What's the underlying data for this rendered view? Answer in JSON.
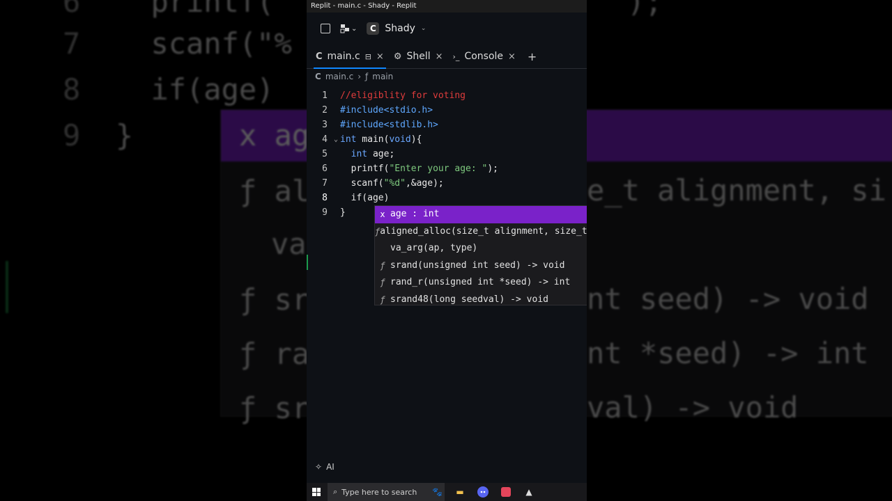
{
  "window": {
    "title": "Replit - main.c - Shady - Replit"
  },
  "toolbar": {
    "project_name": "Shady",
    "logo_letter": "C"
  },
  "tabs": [
    {
      "label": "main.c",
      "icon": "c-file-icon",
      "active": true
    },
    {
      "label": "Shell",
      "icon": "shell-icon",
      "active": false
    },
    {
      "label": "Console",
      "icon": "console-icon",
      "active": false
    }
  ],
  "tab_icons": {
    "c": "C",
    "shell": "⚙",
    "console": "›_",
    "close": "×",
    "add": "+"
  },
  "breadcrumb": {
    "file": "main.c",
    "symbol_icon": "ƒ",
    "symbol": "main"
  },
  "editor": {
    "lines": [
      {
        "num": "1",
        "code": "//eligiblity for voting"
      },
      {
        "num": "2",
        "code": "#include<stdio.h>"
      },
      {
        "num": "3",
        "code": "#include<stdlib.h>"
      },
      {
        "num": "4",
        "kw": "int",
        "fn": " main(",
        "kw2": "void",
        "rest": "){"
      },
      {
        "num": "5",
        "indent": "  ",
        "kw": "int",
        "rest": " age;"
      },
      {
        "num": "6",
        "indent": "  ",
        "pre": "printf(",
        "str": "\"Enter your age: \"",
        "rest": ");"
      },
      {
        "num": "7",
        "indent": "  ",
        "pre": "scanf(",
        "str": "\"%d\"",
        "rest": ",&age);"
      },
      {
        "num": "8",
        "indent": "  ",
        "code": "if(age)"
      },
      {
        "num": "9",
        "code": "}"
      }
    ],
    "fold_marker": "⌄"
  },
  "suggestions": [
    {
      "kind": "x",
      "text": "age : int",
      "selected": true
    },
    {
      "kind": "ƒ",
      "text": "aligned_alloc(size_t alignment, size_t size)",
      "selected": false
    },
    {
      "kind": "",
      "text": "va_arg(ap, type)",
      "selected": false
    },
    {
      "kind": "ƒ",
      "text": "srand(unsigned int seed) -> void",
      "selected": false
    },
    {
      "kind": "ƒ",
      "text": "rand_r(unsigned int *seed) -> int",
      "selected": false
    },
    {
      "kind": "ƒ",
      "text": "srand48(long seedval) -> void",
      "selected": false
    }
  ],
  "aibar": {
    "label": "AI",
    "icon": "✧"
  },
  "taskbar": {
    "search_placeholder": "Type here to search",
    "search_icon": "⌕"
  },
  "background_zoom": {
    "lines": [
      {
        "num": "6",
        "code": "printf(",
        "tail": ");"
      },
      {
        "num": "7",
        "code": "scanf(\"%"
      },
      {
        "num": "8",
        "code": "if(age)"
      },
      {
        "num": "9",
        "code": "}"
      }
    ],
    "popup_items": [
      "x ag",
      "ƒ al",
      "va",
      "ƒ sr",
      "ƒ ra",
      "ƒ sr"
    ],
    "popup_right": [
      "e_t alignment, si",
      "",
      "nt seed) -> void",
      "nt *seed) -> int",
      "val) -> void"
    ]
  },
  "colors": {
    "accent": "#7a22c9",
    "tab_underline": "#0f87ff",
    "comment": "#e03c3c",
    "string": "#7ec97e",
    "keyword": "#6aa7ff"
  }
}
